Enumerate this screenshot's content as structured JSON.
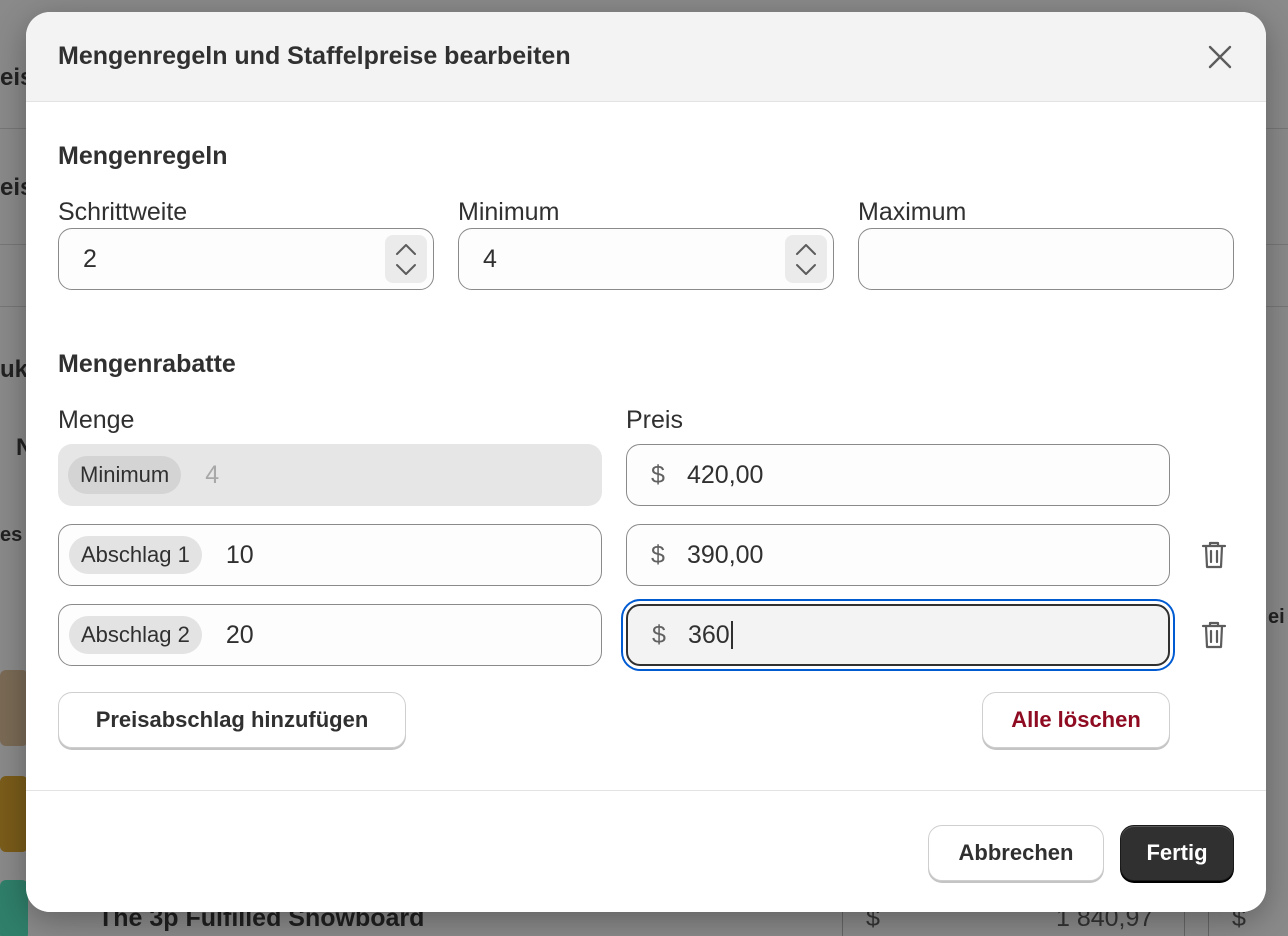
{
  "background": {
    "product_name": "The 3p Fulfilled Snowboard",
    "currency": "$",
    "price": "1 840,97",
    "currency_right": "$"
  },
  "modal": {
    "title": "Mengenregeln und Staffelpreise bearbeiten",
    "quantity_rules": {
      "title": "Mengenregeln",
      "increment": {
        "label": "Schrittweite",
        "value": "2"
      },
      "minimum": {
        "label": "Minimum",
        "value": "4"
      },
      "maximum": {
        "label": "Maximum",
        "value": ""
      }
    },
    "volume_pricing": {
      "title": "Mengenrabatte",
      "col_quantity": "Menge",
      "col_price": "Preis",
      "currency": "$",
      "rows": [
        {
          "tag": "Minimum",
          "quantity": "4",
          "price": "420,00"
        },
        {
          "tag": "Abschlag 1",
          "quantity": "10",
          "price": "390,00"
        },
        {
          "tag": "Abschlag 2",
          "quantity": "20",
          "price": "360"
        }
      ],
      "add_break_label": "Preisabschlag hinzufügen",
      "clear_all_label": "Alle löschen"
    },
    "footer": {
      "cancel_label": "Abbrechen",
      "done_label": "Fertig"
    }
  },
  "colors": {
    "focus_ring": "#005bd3",
    "danger_text": "#8e0b21",
    "primary_button": "#303030"
  }
}
